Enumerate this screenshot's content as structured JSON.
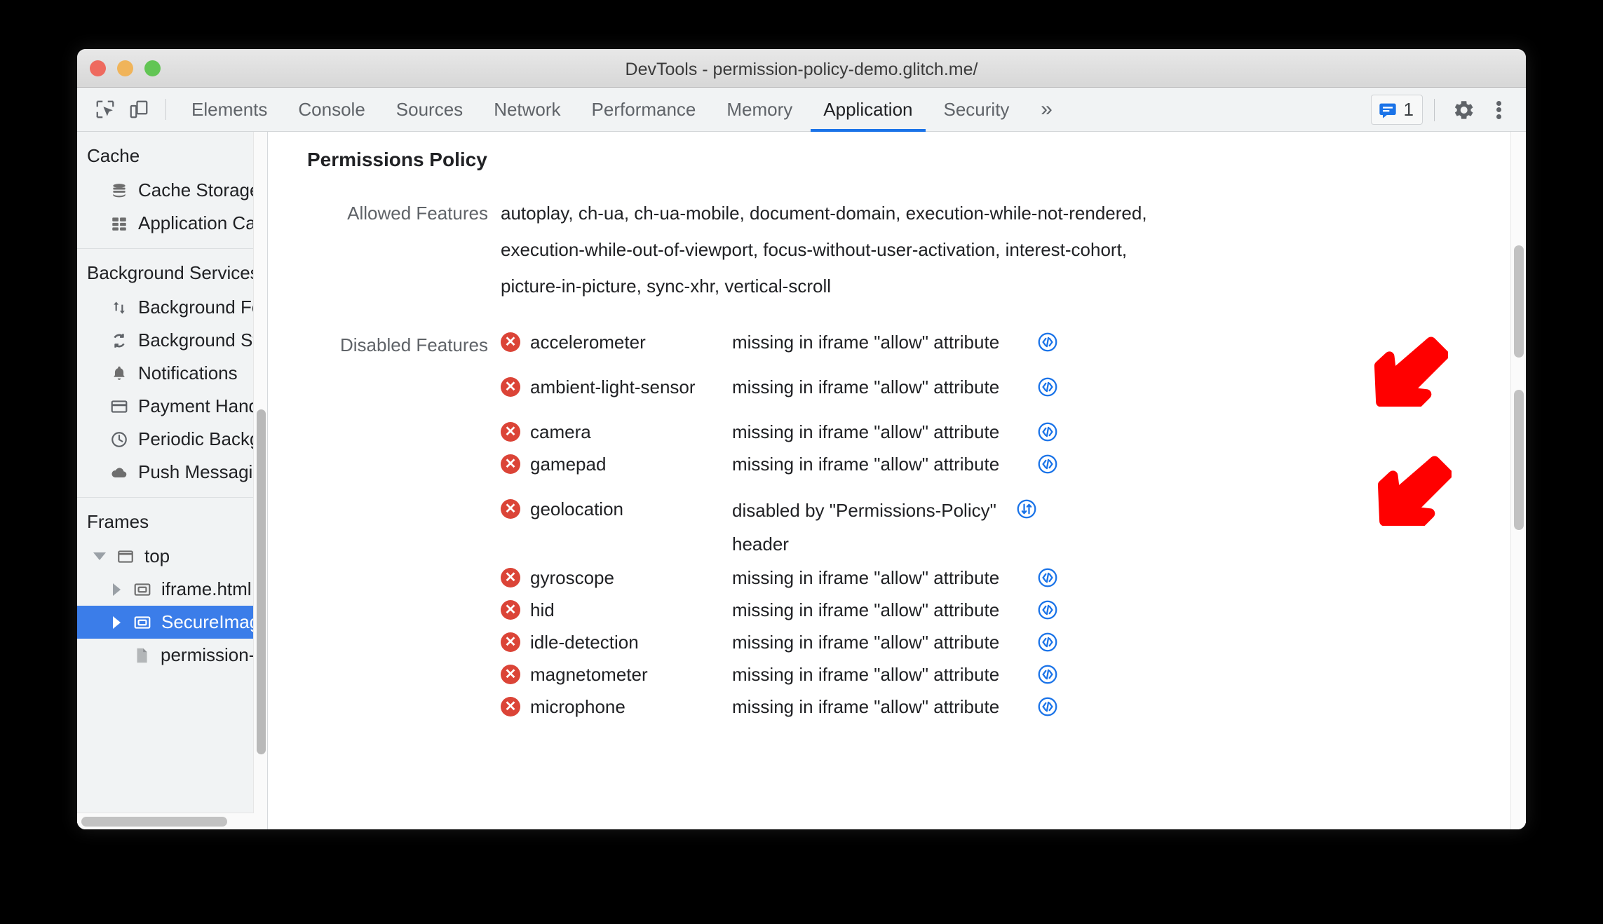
{
  "window": {
    "title": "DevTools - permission-policy-demo.glitch.me/",
    "traffic_lights": [
      "close",
      "minimize",
      "zoom"
    ]
  },
  "toolbar": {
    "inspect_icon": "inspect-element-icon",
    "device_icon": "device-toolbar-icon",
    "tabs": [
      {
        "label": "Elements",
        "active": false
      },
      {
        "label": "Console",
        "active": false
      },
      {
        "label": "Sources",
        "active": false
      },
      {
        "label": "Network",
        "active": false
      },
      {
        "label": "Performance",
        "active": false
      },
      {
        "label": "Memory",
        "active": false
      },
      {
        "label": "Application",
        "active": true
      },
      {
        "label": "Security",
        "active": false
      }
    ],
    "overflow_label": "»",
    "message_count": "1",
    "message_icon": "message-icon",
    "settings_icon": "gear-icon",
    "more_icon": "kebab-menu-icon",
    "accent_color": "#1a73e8"
  },
  "sidebar": {
    "groups": [
      {
        "header": "Cache",
        "items": [
          {
            "label": "Cache Storage",
            "icon": "database-icon",
            "selected": false
          },
          {
            "label": "Application Cache",
            "icon": "grid-icon",
            "selected": false
          }
        ]
      },
      {
        "header": "Background Services",
        "items": [
          {
            "label": "Background Fetch",
            "icon": "up-down-arrows-icon",
            "selected": false
          },
          {
            "label": "Background Sync",
            "icon": "sync-icon",
            "selected": false
          },
          {
            "label": "Notifications",
            "icon": "bell-icon",
            "selected": false
          },
          {
            "label": "Payment Handler",
            "icon": "credit-card-icon",
            "selected": false
          },
          {
            "label": "Periodic Backgroun",
            "icon": "clock-icon",
            "selected": false
          },
          {
            "label": "Push Messaging",
            "icon": "cloud-icon",
            "selected": false
          }
        ]
      },
      {
        "header": "Frames",
        "items": [
          {
            "label": "top",
            "icon": "frame-icon",
            "toggle": "expanded",
            "level": 1,
            "selected": false
          },
          {
            "label": "iframe.html",
            "icon": "iframe-icon",
            "toggle": "collapsed",
            "level": 2,
            "selected": false
          },
          {
            "label": "SecureImage",
            "icon": "iframe-icon",
            "toggle": "collapsed",
            "level": 2,
            "selected": true
          },
          {
            "label": "permission-policy",
            "icon": "document-icon",
            "toggle": "none",
            "level": 3,
            "selected": false
          }
        ]
      }
    ],
    "selected_color": "#3b7de9"
  },
  "main": {
    "panel_title": "Permissions Policy",
    "allowed_label": "Allowed Features",
    "allowed_features": "autoplay, ch-ua, ch-ua-mobile, document-domain, execution-while-not-rendered, execution-while-out-of-viewport, focus-without-user-activation, interest-cohort, picture-in-picture, sync-xhr, vertical-scroll",
    "allowed_lines": [
      "autoplay, ch-ua, ch-ua-mobile, document-domain, execution-while-not-rendered,",
      "execution-while-out-of-viewport, focus-without-user-activation, interest-cohort,",
      "picture-in-picture, sync-xhr, vertical-scroll"
    ],
    "disabled_label": "Disabled Features",
    "disabled_features": [
      {
        "name": "accelerometer",
        "status_icon": "error-x-icon",
        "reason": "missing in iframe \"allow\" attribute",
        "action_icon": "source-code-icon"
      },
      {
        "name": "ambient-light-sensor",
        "status_icon": "error-x-icon",
        "reason": "missing in iframe \"allow\" attribute",
        "action_icon": "source-code-icon"
      },
      {
        "name": "camera",
        "status_icon": "error-x-icon",
        "reason": "missing in iframe \"allow\" attribute",
        "action_icon": "source-code-icon"
      },
      {
        "name": "gamepad",
        "status_icon": "error-x-icon",
        "reason": "missing in iframe \"allow\" attribute",
        "action_icon": "source-code-icon"
      },
      {
        "name": "geolocation",
        "status_icon": "error-x-icon",
        "reason": "disabled by \"Permissions-Policy\" header",
        "action_icon": "network-request-icon"
      },
      {
        "name": "gyroscope",
        "status_icon": "error-x-icon",
        "reason": "missing in iframe \"allow\" attribute",
        "action_icon": "source-code-icon"
      },
      {
        "name": "hid",
        "status_icon": "error-x-icon",
        "reason": "missing in iframe \"allow\" attribute",
        "action_icon": "source-code-icon"
      },
      {
        "name": "idle-detection",
        "status_icon": "error-x-icon",
        "reason": "missing in iframe \"allow\" attribute",
        "action_icon": "source-code-icon"
      },
      {
        "name": "magnetometer",
        "status_icon": "error-x-icon",
        "reason": "missing in iframe \"allow\" attribute",
        "action_icon": "source-code-icon"
      },
      {
        "name": "microphone",
        "status_icon": "error-x-icon",
        "reason": "missing in iframe \"allow\" attribute",
        "action_icon": "source-code-icon"
      }
    ],
    "error_color": "#db4437",
    "link_color": "#1a73e8"
  },
  "annotations": {
    "arrow_color": "#ff0000",
    "arrows": [
      {
        "name": "arrow-pointing-to-accelerometer-source-icon"
      },
      {
        "name": "arrow-pointing-to-geolocation-network-icon"
      }
    ]
  }
}
